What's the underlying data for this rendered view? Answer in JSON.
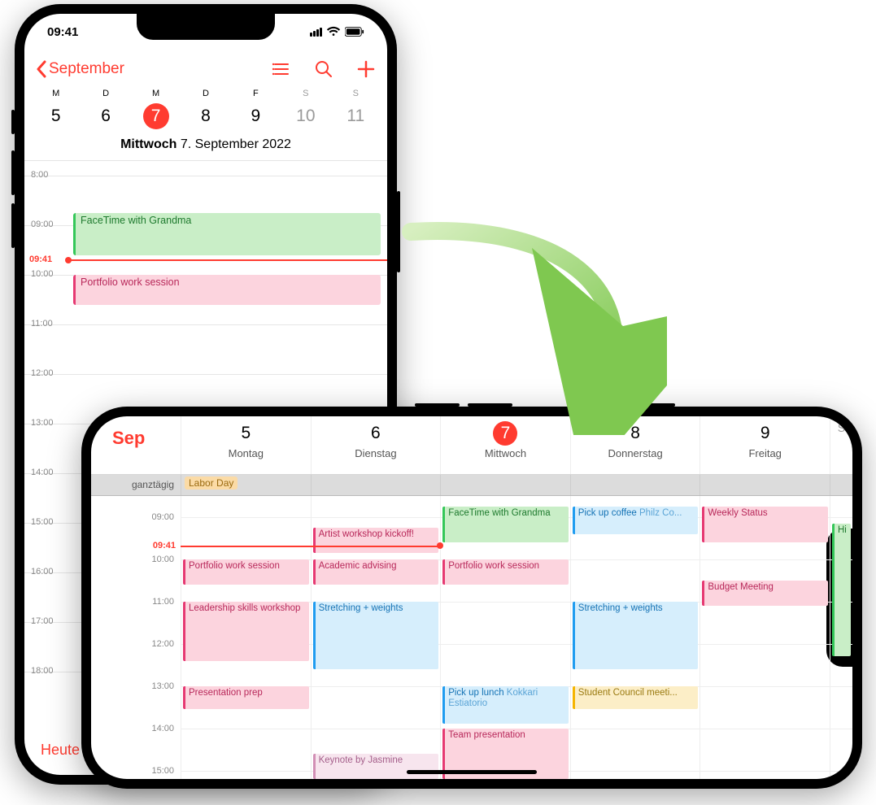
{
  "status": {
    "time": "09:41"
  },
  "portrait": {
    "back_label": "September",
    "week_letters": [
      "M",
      "D",
      "M",
      "D",
      "F",
      "S",
      "S"
    ],
    "week_days": [
      {
        "n": "5"
      },
      {
        "n": "6"
      },
      {
        "n": "7",
        "selected": true
      },
      {
        "n": "8"
      },
      {
        "n": "9"
      },
      {
        "n": "10",
        "weekend": true
      },
      {
        "n": "11",
        "weekend": true
      }
    ],
    "date_title_day": "Mittwoch",
    "date_title_rest": "  7. September 2022",
    "now_label": "09:41",
    "hours": [
      "8:00",
      "09:00",
      "10:00",
      "11:00",
      "12:00",
      "13:00",
      "14:00",
      "15:00",
      "16:00",
      "17:00",
      "18:00"
    ],
    "events": [
      {
        "title": "FaceTime with Grandma",
        "cls": "ev-green",
        "start": 8.75,
        "end": 9.6
      },
      {
        "title": "Portfolio work session",
        "cls": "ev-pink",
        "start": 10.0,
        "end": 10.6
      }
    ],
    "today_label": "Heute"
  },
  "landscape": {
    "month": "Sep",
    "days": [
      {
        "n": "5",
        "name": "Montag"
      },
      {
        "n": "6",
        "name": "Dienstag"
      },
      {
        "n": "7",
        "name": "Mittwoch",
        "selected": true
      },
      {
        "n": "8",
        "name": "Donnerstag"
      },
      {
        "n": "9",
        "name": "Freitag"
      }
    ],
    "sat_letter": "S",
    "allday_label": "ganztägig",
    "allday_events": {
      "0": "Labor Day"
    },
    "hours": [
      "09:00",
      "10:00",
      "11:00",
      "12:00",
      "13:00",
      "14:00",
      "15:00"
    ],
    "now_label": "09:41",
    "grid": {
      "0": [
        {
          "t": "Portfolio work session",
          "cls": "c-pink",
          "s": 10.0,
          "e": 10.6
        },
        {
          "t": "Leadership skills workshop",
          "cls": "c-pink",
          "s": 11.0,
          "e": 12.4,
          "wrap": true
        },
        {
          "t": "Presentation prep",
          "cls": "c-pink",
          "s": 13.0,
          "e": 13.55
        }
      ],
      "1": [
        {
          "t": "Artist workshop kickoff!",
          "cls": "c-pink",
          "s": 9.25,
          "e": 9.85
        },
        {
          "t": "Academic advising",
          "cls": "c-pink",
          "s": 10.0,
          "e": 10.6
        },
        {
          "t": "Stretching + weights",
          "cls": "c-blue",
          "s": 11.0,
          "e": 12.6
        },
        {
          "t": "Keynote by Jasmine",
          "cls": "c-pinklt",
          "s": 14.6,
          "e": 15.2
        }
      ],
      "2": [
        {
          "t": "FaceTime with Grandma",
          "cls": "c-green",
          "s": 8.75,
          "e": 9.6
        },
        {
          "t": "Portfolio work session",
          "cls": "c-pink",
          "s": 10.0,
          "e": 10.6
        },
        {
          "t": "Pick up lunch",
          "sub": "Kokkari Estiatorio",
          "cls": "c-blue",
          "s": 13.0,
          "e": 13.9,
          "wrap": true
        },
        {
          "t": "Team presentation",
          "cls": "c-pink",
          "s": 14.0,
          "e": 15.2
        }
      ],
      "3": [
        {
          "t": "Pick up coffee ",
          "sub": "Philz Co...",
          "cls": "c-blue",
          "s": 8.75,
          "e": 9.4
        },
        {
          "t": "Stretching + weights",
          "cls": "c-blue",
          "s": 11.0,
          "e": 12.6
        },
        {
          "t": "Student Council meeti...",
          "cls": "c-yellow",
          "s": 13.0,
          "e": 13.55
        }
      ],
      "4": [
        {
          "t": "Weekly Status",
          "cls": "c-pink",
          "s": 8.75,
          "e": 9.6
        },
        {
          "t": "Budget Meeting",
          "cls": "c-pink",
          "s": 10.5,
          "e": 11.1
        }
      ],
      "sat": [
        {
          "t": "Hi",
          "cls": "c-green",
          "s": 9.15,
          "e": 12.3
        }
      ]
    }
  }
}
